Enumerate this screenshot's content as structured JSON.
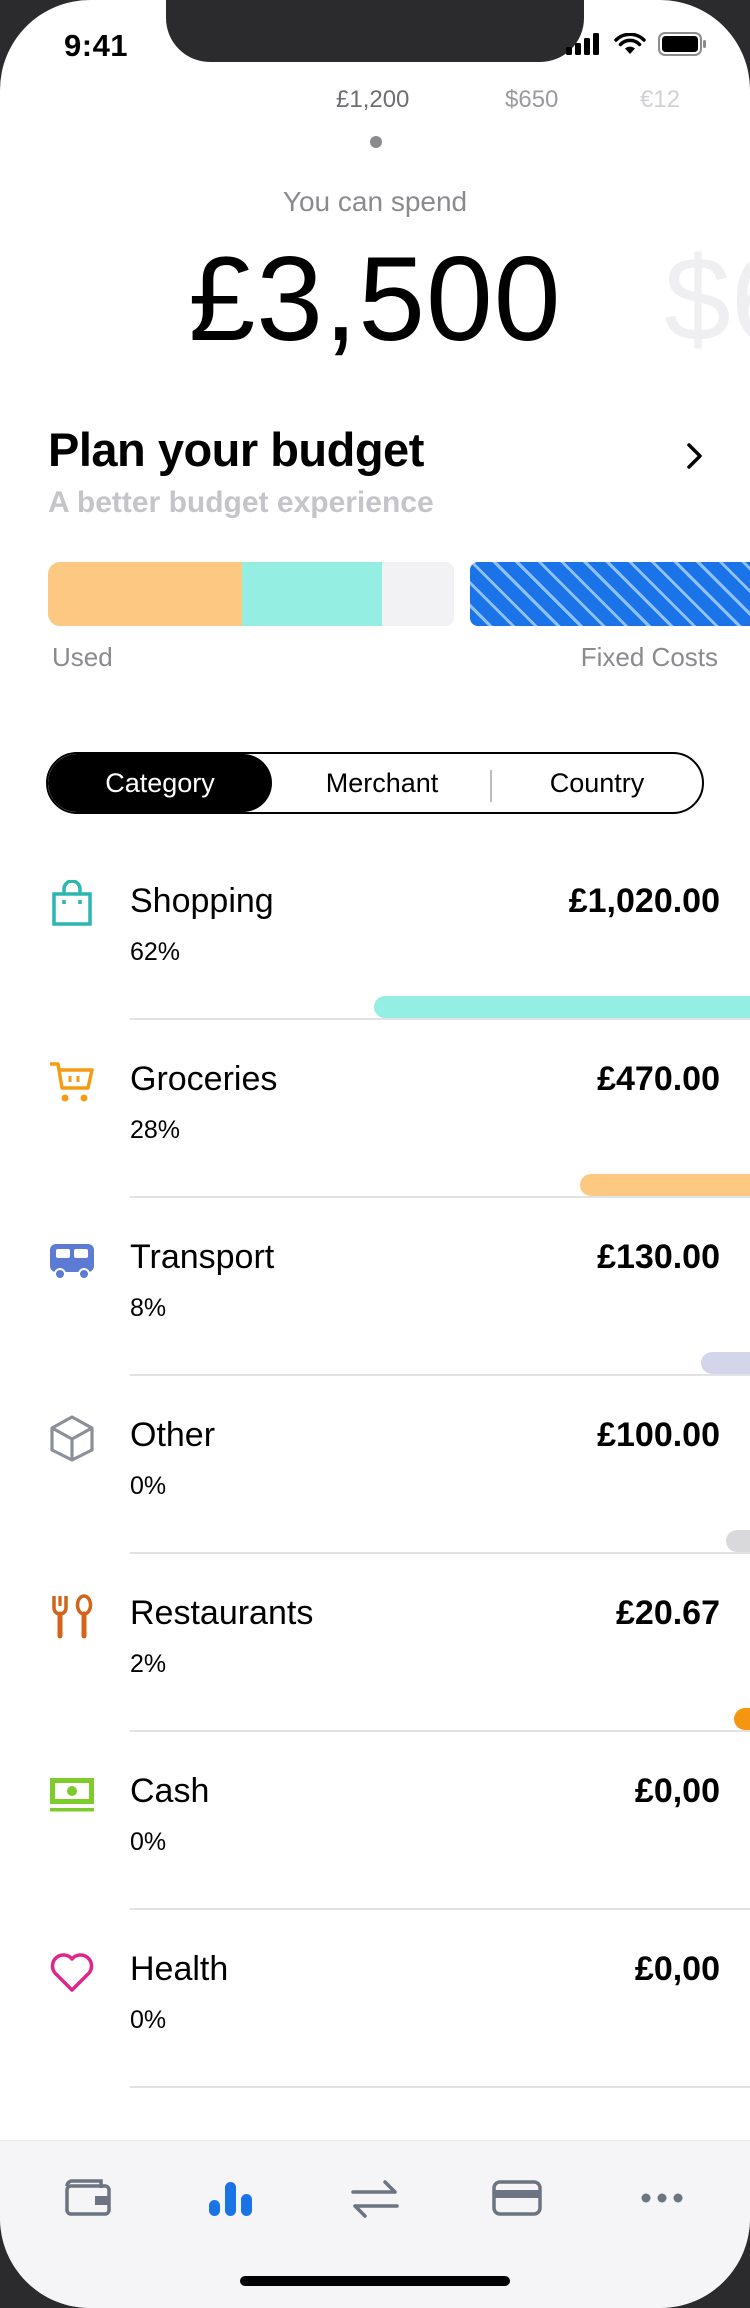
{
  "status_bar": {
    "time": "9:41"
  },
  "currency_tabs": [
    {
      "label": "£1,200",
      "active": true
    },
    {
      "label": "$650",
      "active": false
    },
    {
      "label": "€12",
      "active": false
    }
  ],
  "spend": {
    "label": "You can spend",
    "amount": "£3,500",
    "next_amount_peek": "$6"
  },
  "plan": {
    "title": "Plan your budget",
    "subtitle": "A better budget experience"
  },
  "budget_bar": {
    "used_label": "Used",
    "fixed_label": "Fixed Costs",
    "colors": {
      "used": "#fdc982",
      "teal": "#95eee2",
      "remaining": "#f2f2f4",
      "fixed": "#1a74e8"
    }
  },
  "segments": [
    {
      "label": "Category",
      "active": true
    },
    {
      "label": "Merchant",
      "active": false
    },
    {
      "label": "Country",
      "active": false
    }
  ],
  "categories": [
    {
      "name": "Shopping",
      "percent": "62%",
      "amount": "£1,020.00",
      "icon": "shopping-bag-icon",
      "color": "#2bb7b0",
      "bar_color": "#95eee2",
      "share": 0.62
    },
    {
      "name": "Groceries",
      "percent": "28%",
      "amount": "£470.00",
      "icon": "shopping-cart-icon",
      "color": "#f59b12",
      "bar_color": "#fdc982",
      "share": 0.28
    },
    {
      "name": "Transport",
      "percent": "8%",
      "amount": "£130.00",
      "icon": "bus-icon",
      "color": "#5b7bd5",
      "bar_color": "#d3d6ea",
      "share": 0.08
    },
    {
      "name": "Other",
      "percent": "0%",
      "amount": "£100.00",
      "icon": "box-icon",
      "color": "#8a8f98",
      "bar_color": "#d9d9dc",
      "share": 0.04
    },
    {
      "name": "Restaurants",
      "percent": "2%",
      "amount": "£20.67",
      "icon": "cutlery-icon",
      "color": "#d4641a",
      "bar_color": "#f5960f",
      "share": 0.02
    },
    {
      "name": "Cash",
      "percent": "0%",
      "amount": "£0,00",
      "icon": "cash-icon",
      "color": "#7ccd2c",
      "bar_color": "",
      "share": 0
    },
    {
      "name": "Health",
      "percent": "0%",
      "amount": "£0,00",
      "icon": "heart-icon",
      "color": "#e1268a",
      "bar_color": "",
      "share": 0
    }
  ],
  "tabbar": {
    "items": [
      {
        "icon": "wallet-icon",
        "active": false
      },
      {
        "icon": "bar-chart-icon",
        "active": true
      },
      {
        "icon": "transfer-icon",
        "active": false
      },
      {
        "icon": "card-icon",
        "active": false
      },
      {
        "icon": "more-icon",
        "active": false
      }
    ],
    "active_color": "#1a74e8",
    "inactive_color": "#6b7480"
  }
}
